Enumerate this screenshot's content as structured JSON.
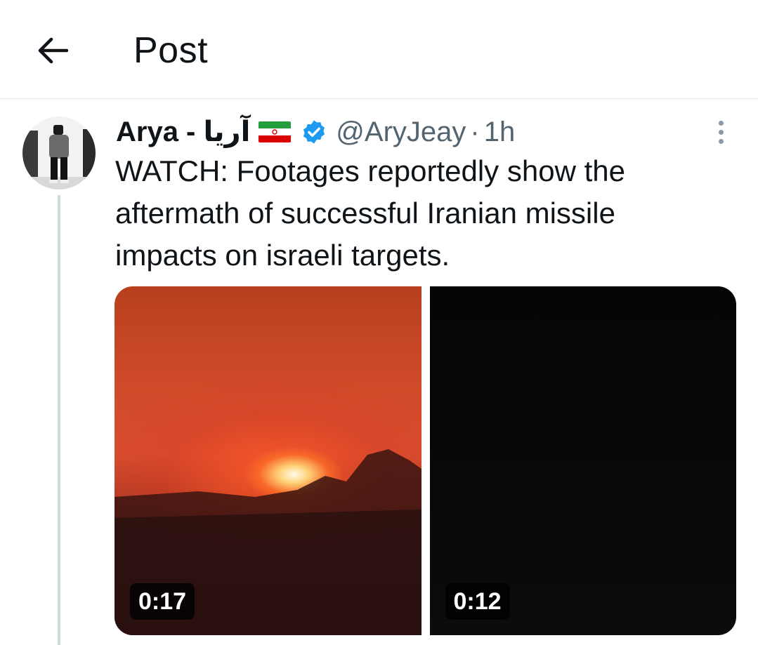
{
  "header": {
    "title": "Post",
    "back_icon": "arrow-left-icon"
  },
  "post": {
    "author": {
      "display_name": "Arya - آریا",
      "flag_icon": "iran-flag-icon",
      "verified_icon": "verified-badge-icon",
      "verified_color": "#1d9bf0",
      "handle": "@AryJeay",
      "separator": "·",
      "time": "1h"
    },
    "text_lines": [
      "WATCH: Footages reportedly show the",
      "aftermath of successful Iranian missile",
      "impacts on israeli targets."
    ],
    "media": [
      {
        "type": "video",
        "duration": "0:17"
      },
      {
        "type": "video",
        "duration": "0:12"
      }
    ],
    "more_icon": "more-vertical-icon"
  },
  "colors": {
    "text": "#0f1419",
    "secondary": "#536471",
    "divider": "#e3e6ea",
    "thread_line": "#cfd9de"
  }
}
